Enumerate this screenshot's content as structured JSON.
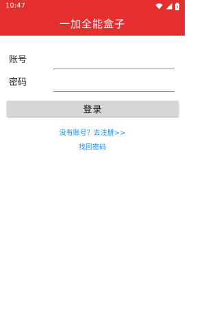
{
  "status_bar": {
    "time": "10:47",
    "icons": [
      "wifi-icon",
      "signal-icon",
      "battery-icon"
    ],
    "color": "#e52e2e"
  },
  "app_bar": {
    "title": "一加全能盒子",
    "color": "#e52e2e"
  },
  "form": {
    "account_label": "账号",
    "account_value": "",
    "password_label": "密码",
    "password_value": ""
  },
  "login_button": {
    "label": "登录"
  },
  "links": {
    "register": "没有账号？去注册>>",
    "recover": "找回密码",
    "color": "#1e88e5"
  }
}
